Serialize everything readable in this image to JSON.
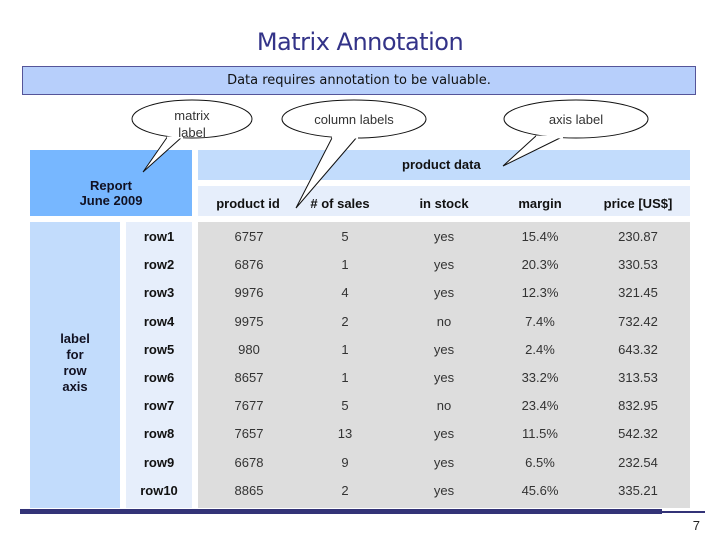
{
  "slide": {
    "title": "Matrix Annotation",
    "banner": "Data requires annotation to be valuable.",
    "page_number": "7"
  },
  "callouts": {
    "matrix_label": "matrix label",
    "matrix_label_line1": "matrix",
    "matrix_label_line2": "label",
    "column_labels": "column labels",
    "axis_label": "axis label"
  },
  "matrix": {
    "label_line1": "Report",
    "label_line2": "June 2009",
    "column_axis_label": "product data",
    "row_axis_label_lines": [
      "label",
      "for",
      "row",
      "axis"
    ],
    "columns": [
      "product id",
      "# of sales",
      "in stock",
      "margin",
      "price [US$]"
    ],
    "rows": [
      {
        "label": "row1",
        "cells": [
          "6757",
          "5",
          "yes",
          "15.4%",
          "230.87"
        ]
      },
      {
        "label": "row2",
        "cells": [
          "6876",
          "1",
          "yes",
          "20.3%",
          "330.53"
        ]
      },
      {
        "label": "row3",
        "cells": [
          "9976",
          "4",
          "yes",
          "12.3%",
          "321.45"
        ]
      },
      {
        "label": "row4",
        "cells": [
          "9975",
          "2",
          "no",
          "7.4%",
          "732.42"
        ]
      },
      {
        "label": "row5",
        "cells": [
          "980",
          "1",
          "yes",
          "2.4%",
          "643.32"
        ]
      },
      {
        "label": "row6",
        "cells": [
          "8657",
          "1",
          "yes",
          "33.2%",
          "313.53"
        ]
      },
      {
        "label": "row7",
        "cells": [
          "7677",
          "5",
          "no",
          "23.4%",
          "832.95"
        ]
      },
      {
        "label": "row8",
        "cells": [
          "7657",
          "13",
          "yes",
          "11.5%",
          "542.32"
        ]
      },
      {
        "label": "row9",
        "cells": [
          "6678",
          "9",
          "yes",
          "6.5%",
          "232.54"
        ]
      },
      {
        "label": "row10",
        "cells": [
          "8865",
          "2",
          "yes",
          "45.6%",
          "335.21"
        ]
      }
    ]
  }
}
